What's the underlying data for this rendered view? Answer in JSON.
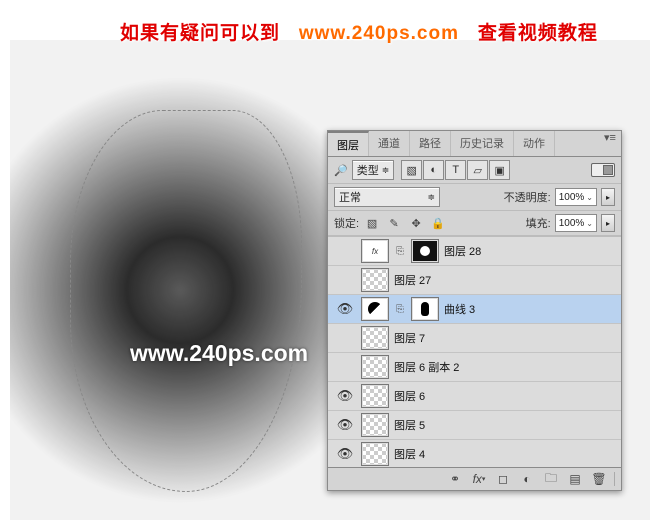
{
  "header": {
    "part1": "如果有疑问可以到",
    "url": "www.240ps.com",
    "part3": "查看视频教程"
  },
  "watermark": "www.240ps.com",
  "panel": {
    "tabs": [
      "图层",
      "通道",
      "路径",
      "历史记录",
      "动作"
    ],
    "active_tab": 0,
    "filter_label": "类型",
    "blend_mode": "正常",
    "opacity_label": "不透明度:",
    "opacity_value": "100%",
    "lock_label": "锁定:",
    "fill_label": "填充:",
    "fill_value": "100%"
  },
  "layers": [
    {
      "visible": false,
      "type": "masked",
      "name": "图层 28"
    },
    {
      "visible": false,
      "type": "checker",
      "name": "图层 27"
    },
    {
      "visible": true,
      "type": "adj",
      "name": "曲线 3",
      "selected": true
    },
    {
      "visible": false,
      "type": "checker",
      "name": "图层 7"
    },
    {
      "visible": false,
      "type": "checker",
      "name": "图层 6 副本 2"
    },
    {
      "visible": true,
      "type": "checker",
      "name": "图层 6"
    },
    {
      "visible": true,
      "type": "checker",
      "name": "图层 5"
    },
    {
      "visible": true,
      "type": "checker",
      "name": "图层 4"
    }
  ]
}
